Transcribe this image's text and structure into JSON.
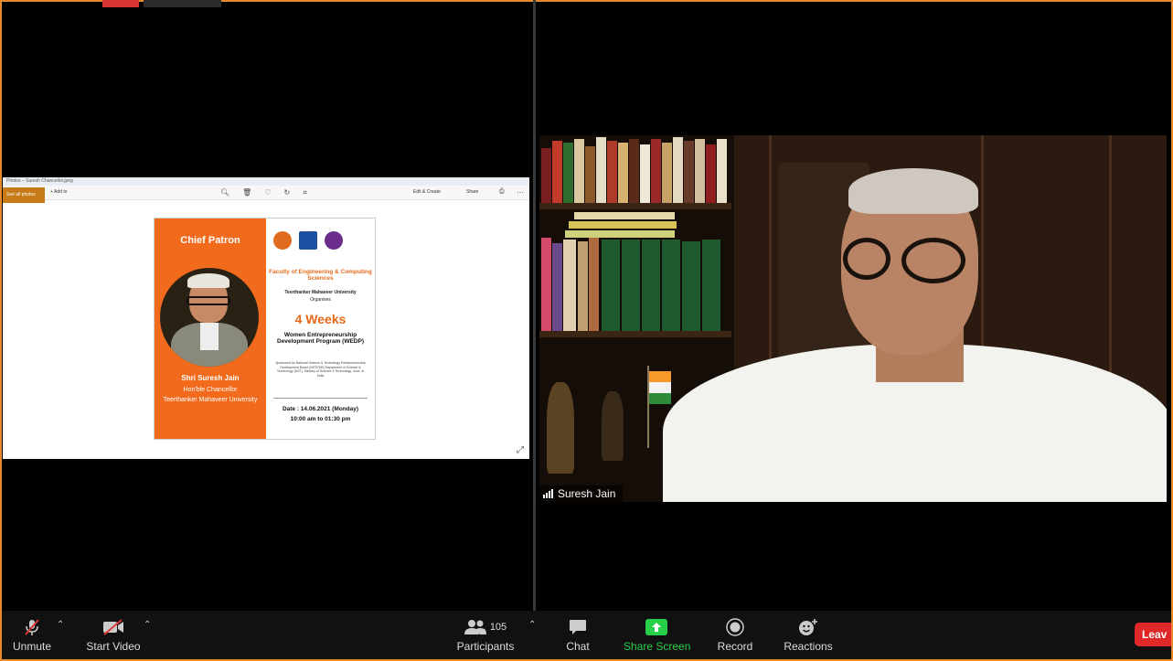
{
  "share": {
    "title_bar": "Photos – Suresh Chancellor.jpeg",
    "see_all_label": "See all photos",
    "add_to_label": "+ Add to",
    "edit_label": "Edit & Create",
    "share_label": "Share",
    "poster": {
      "chief_patron": "Chief Patron",
      "patron_name": "Shri Suresh Jain",
      "patron_role": "Hon'ble Chancellor",
      "patron_university": "Teerthanker Mahaveer University",
      "faculty": "Faculty of Engineering & Computing Sciences",
      "university": "Teerthanker Mahaveer University",
      "organises": "Organises",
      "duration": "4 Weeks",
      "program": "Women Entrepreneurship Development Program (WEDP)",
      "sponsor_note": "Sponsored by National Science & Technology Entrepreneurship Development Board (NSTEDB) Department of Science & Technology (DST), Ministry of Science & Technology, Govt. of India",
      "date": "Date : 14.06.2021 (Monday)",
      "time": "10:00 am to 01:30 pm"
    }
  },
  "video": {
    "participant_name": "Suresh Jain"
  },
  "toolbar": {
    "unmute_label": "Unmute",
    "start_video_label": "Start Video",
    "participants_label": "Participants",
    "participants_count": "105",
    "chat_label": "Chat",
    "share_screen_label": "Share Screen",
    "record_label": "Record",
    "reactions_label": "Reactions",
    "leave_label": "Leav"
  },
  "colors": {
    "accent_border": "#e8892a",
    "share_screen_green": "#26d049",
    "leave_red": "#e02828",
    "poster_orange": "#f26a1b"
  }
}
